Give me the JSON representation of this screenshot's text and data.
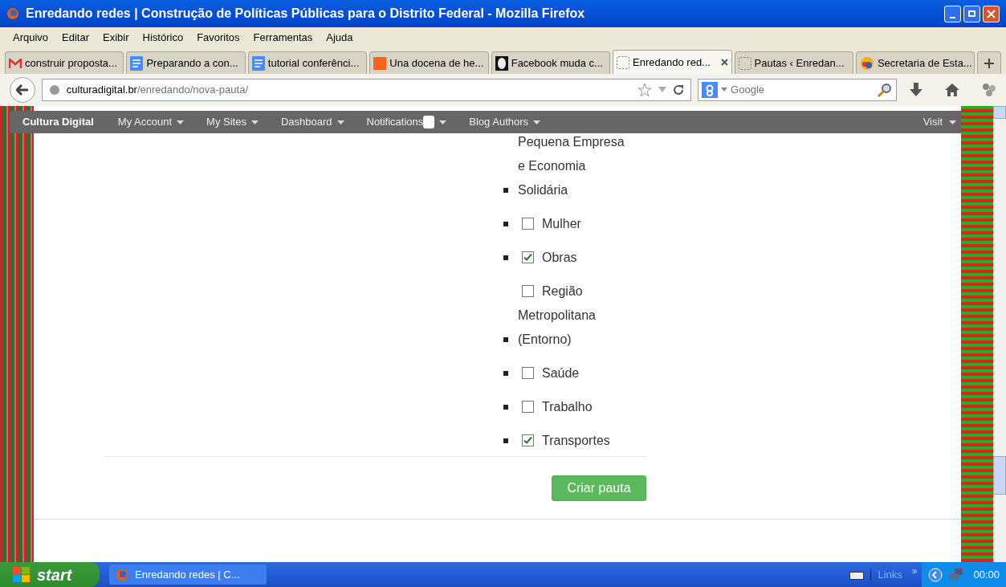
{
  "window": {
    "title": "Enredando redes | Construção de Políticas Públicas para o Distrito Federal - Mozilla Firefox"
  },
  "menu": [
    "Arquivo",
    "Editar",
    "Exibir",
    "Histórico",
    "Favoritos",
    "Ferramentas",
    "Ajuda"
  ],
  "tabs": [
    {
      "label": "construir proposta...",
      "selected": false
    },
    {
      "label": "Preparando a con...",
      "selected": false
    },
    {
      "label": "tutorial conferênci...",
      "selected": false
    },
    {
      "label": "Una docena de he...",
      "selected": false
    },
    {
      "label": "Facebook muda c...",
      "selected": false
    },
    {
      "label": "Enredando red...",
      "selected": true
    },
    {
      "label": "Pautas ‹ Enredan...",
      "selected": false
    },
    {
      "label": "Secretaria de Esta...",
      "selected": false
    }
  ],
  "address": {
    "host": "culturadigital.br",
    "path": "/enredando/nova-pauta/"
  },
  "search": {
    "placeholder": "Google"
  },
  "admin_bar": {
    "site": "Cultura Digital",
    "items": [
      "My Account",
      "My Sites",
      "Dashboard",
      "Notifications",
      "Blog Authors"
    ],
    "right": "Visit"
  },
  "topics": [
    {
      "kind": "text",
      "label": "Pequena Empresa e Economia Solidária"
    },
    {
      "kind": "checkbox",
      "label": "Mulher",
      "checked": false
    },
    {
      "kind": "checkbox",
      "label": "Obras",
      "checked": true
    },
    {
      "kind": "checkbox",
      "label": "Região Metropolitana (Entorno)",
      "checked": false
    },
    {
      "kind": "checkbox",
      "label": "Saúde",
      "checked": false
    },
    {
      "kind": "checkbox",
      "label": "Trabalho",
      "checked": false
    },
    {
      "kind": "checkbox",
      "label": "Transportes",
      "checked": true
    }
  ],
  "submit": "Criar pauta",
  "taskbar": {
    "start": "start",
    "task": "Enredando redes | C...",
    "links": "Links",
    "more": "»",
    "clock": "00:00"
  }
}
